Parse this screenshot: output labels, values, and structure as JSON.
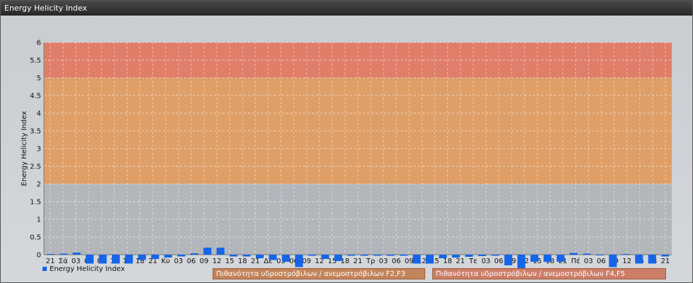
{
  "window": {
    "title": "Energy Helicity Index"
  },
  "chart_data": {
    "type": "bar",
    "ylabel": "Energy Helicity Index",
    "ylim": [
      0,
      6
    ],
    "yticks": [
      "0",
      "0.5",
      "1",
      "1.5",
      "2",
      "2.5",
      "3",
      "3.5",
      "4",
      "4.5",
      "5",
      "5.5",
      "6"
    ],
    "x_tick_labels": [
      "21",
      "Σά",
      "03",
      "06",
      "09",
      "12",
      "15",
      "18",
      "21",
      "Κυ",
      "03",
      "06",
      "09",
      "12",
      "15",
      "18",
      "21",
      "Δε",
      "03",
      "06",
      "09",
      "12",
      "15",
      "18",
      "21",
      "Τρ",
      "03",
      "06",
      "09",
      "12",
      "15",
      "18",
      "21",
      "Τε",
      "03",
      "06",
      "09",
      "12",
      "15",
      "18",
      "21",
      "Πέ",
      "03",
      "06",
      "09",
      "12",
      "15",
      "18",
      "21"
    ],
    "series": [
      {
        "name": "Energy Helicity Index",
        "color": "#1565e8",
        "values": [
          0.02,
          0.03,
          0.06,
          -0.25,
          -0.25,
          -0.25,
          -0.25,
          -0.15,
          -0.12,
          -0.08,
          -0.05,
          0.04,
          0.2,
          0.2,
          -0.05,
          -0.05,
          -0.1,
          -0.15,
          -0.2,
          -0.35,
          -0.03,
          -0.12,
          -0.18,
          -0.03,
          -0.03,
          -0.03,
          -0.03,
          -0.03,
          -0.25,
          -0.25,
          -0.1,
          -0.08,
          -0.06,
          -0.04,
          -0.03,
          -0.3,
          -0.55,
          -0.2,
          -0.2,
          -0.2,
          0.05,
          0.03,
          -0.02,
          -0.35,
          0.02,
          -0.25,
          -0.25,
          -0.05
        ]
      }
    ],
    "bands": [
      {
        "from": 0,
        "to": 2,
        "color": "#b4b8bd"
      },
      {
        "from": 2,
        "to": 5,
        "color": "#e0a068"
      },
      {
        "from": 5,
        "to": 6,
        "color": "#e27f6a"
      }
    ],
    "grid": true,
    "legend": "bottom-left"
  },
  "band_labels": [
    "Πιθανότητα υδροστρόβιλων / ανεμοστρόβιλων F2,F3",
    "Πιθανότητα υδροστρόβιλων / ανεμοστρόβιλων F4,F5"
  ]
}
